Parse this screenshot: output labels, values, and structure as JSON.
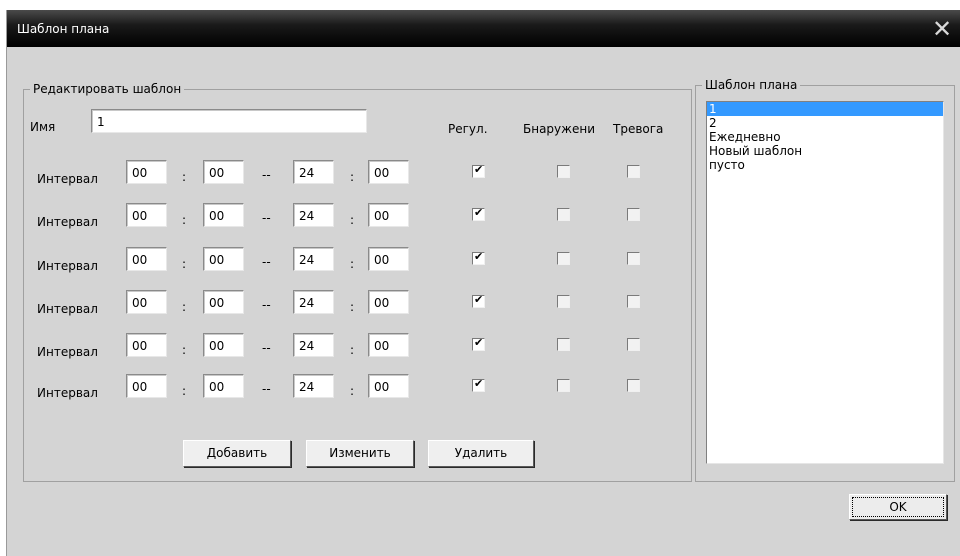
{
  "window": {
    "title": "Шаблон плана",
    "close_icon": "close-icon"
  },
  "edit_group": {
    "legend": "Редактировать шаблон",
    "name_label": "Имя",
    "name_value": "1",
    "col_regular": "Регул.",
    "col_detect": "Бнаружени",
    "col_alarm": "Тревога",
    "sep_colon": ":",
    "sep_dash": "--",
    "intervals": [
      {
        "label": "Интервал",
        "start_h": "00",
        "start_m": "00",
        "end_h": "24",
        "end_m": "00",
        "regular": true,
        "detect": false,
        "alarm": false
      },
      {
        "label": "Интервал",
        "start_h": "00",
        "start_m": "00",
        "end_h": "24",
        "end_m": "00",
        "regular": true,
        "detect": false,
        "alarm": false
      },
      {
        "label": "Интервал",
        "start_h": "00",
        "start_m": "00",
        "end_h": "24",
        "end_m": "00",
        "regular": true,
        "detect": false,
        "alarm": false
      },
      {
        "label": "Интервал",
        "start_h": "00",
        "start_m": "00",
        "end_h": "24",
        "end_m": "00",
        "regular": true,
        "detect": false,
        "alarm": false
      },
      {
        "label": "Интервал",
        "start_h": "00",
        "start_m": "00",
        "end_h": "24",
        "end_m": "00",
        "regular": true,
        "detect": false,
        "alarm": false
      },
      {
        "label": "Интервал",
        "start_h": "00",
        "start_m": "00",
        "end_h": "24",
        "end_m": "00",
        "regular": true,
        "detect": false,
        "alarm": false
      }
    ],
    "buttons": {
      "add": "Добавить",
      "change": "Изменить",
      "delete": "Удалить"
    }
  },
  "plan_group": {
    "legend": "Шаблон плана",
    "items": [
      "1",
      "2",
      "Ежедневно",
      "Новый шаблон",
      "пусто"
    ],
    "selected": 0
  },
  "ok_label": "OK",
  "colors": {
    "selection": "#3399ff",
    "dialog_bg": "#d4d4d4",
    "titlebar": "#000000"
  }
}
